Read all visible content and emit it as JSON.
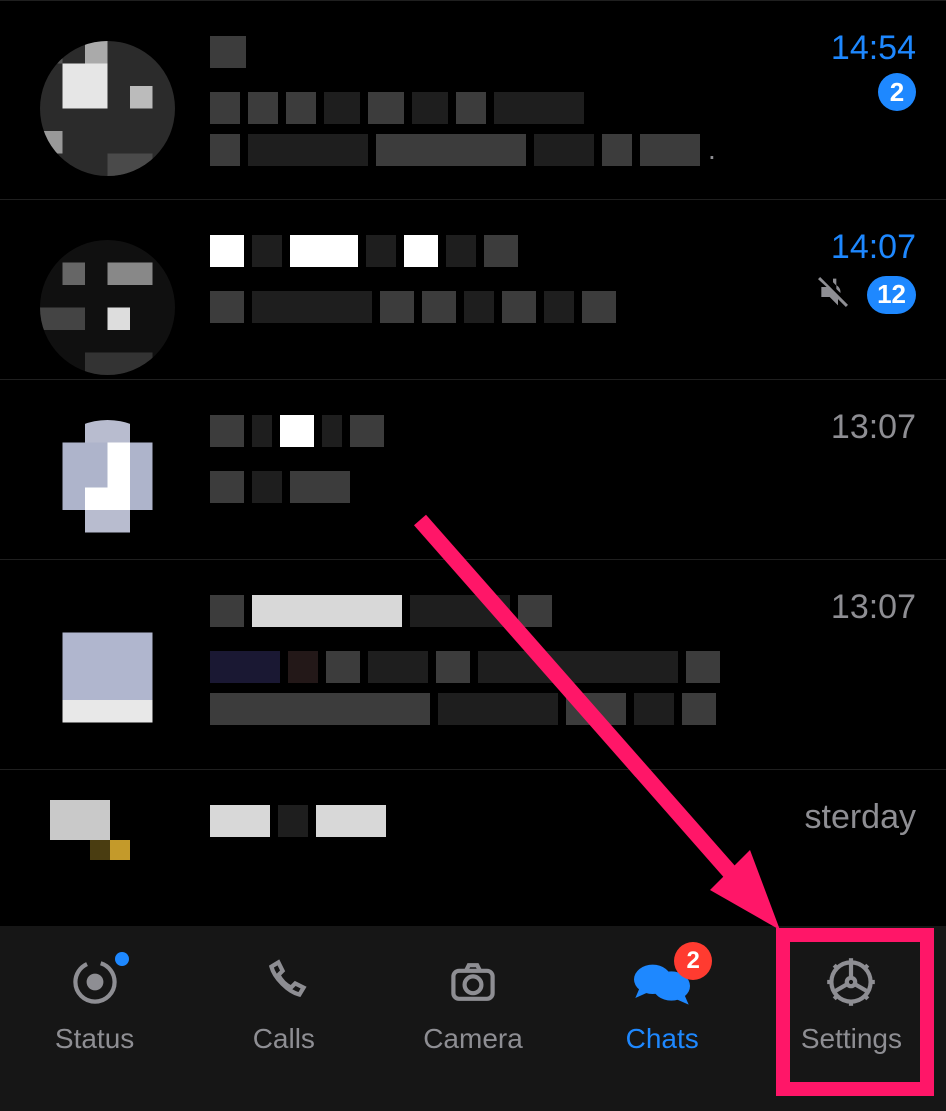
{
  "colors": {
    "accent": "#1e88ff",
    "badge_red": "#ff3b30",
    "annotation": "#ff1668",
    "time_default": "#8e8e93"
  },
  "chats": [
    {
      "time": "14:54",
      "unread_count": "2",
      "muted": false,
      "time_highlight": true
    },
    {
      "time": "14:07",
      "unread_count": "12",
      "muted": true,
      "time_highlight": true
    },
    {
      "time": "13:07",
      "unread_count": "",
      "muted": false,
      "time_highlight": false
    },
    {
      "time": "13:07",
      "unread_count": "",
      "muted": false,
      "time_highlight": false
    },
    {
      "time": "sterday",
      "unread_count": "",
      "muted": false,
      "time_highlight": false
    }
  ],
  "tabs": {
    "status": {
      "label": "Status",
      "has_dot": true
    },
    "calls": {
      "label": "Calls"
    },
    "camera": {
      "label": "Camera"
    },
    "chats": {
      "label": "Chats",
      "badge": "2",
      "active": true
    },
    "settings": {
      "label": "Settings"
    }
  }
}
